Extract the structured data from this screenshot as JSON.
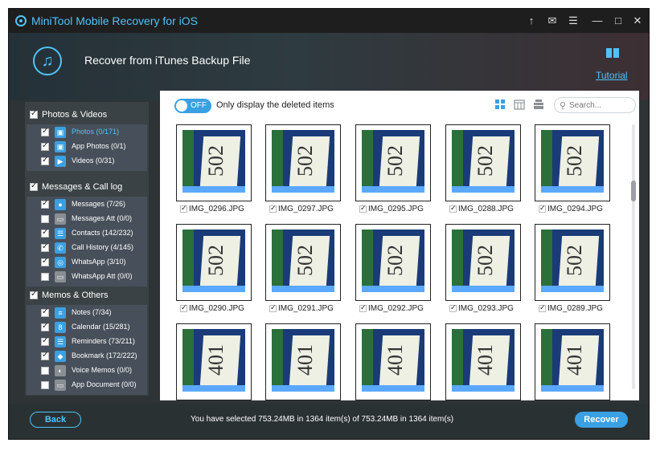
{
  "window": {
    "title": "MiniTool Mobile Recovery for iOS",
    "controls": [
      "↑",
      "✉",
      "☰",
      "—",
      "□",
      "✕"
    ]
  },
  "header": {
    "title": "Recover from iTunes Backup File",
    "tutorial_label": "Tutorial"
  },
  "sidebar": {
    "groups": [
      {
        "label": "Photos & Videos",
        "checked": true,
        "items": [
          {
            "label": "Photos (0/171)",
            "checked": true,
            "icon": "photo-icon",
            "selected": true
          },
          {
            "label": "App Photos (0/1)",
            "checked": true,
            "icon": "app-photo-icon"
          },
          {
            "label": "Videos (0/31)",
            "checked": true,
            "icon": "video-icon"
          }
        ]
      },
      {
        "label": "Messages & Call log",
        "checked": true,
        "items": [
          {
            "label": "Messages (7/26)",
            "checked": true,
            "icon": "message-icon"
          },
          {
            "label": "Messages Att (0/0)",
            "checked": false,
            "icon": "attachment-icon",
            "disabled": true
          },
          {
            "label": "Contacts (142/232)",
            "checked": true,
            "icon": "contacts-icon"
          },
          {
            "label": "Call History (4/145)",
            "checked": true,
            "icon": "call-history-icon"
          },
          {
            "label": "WhatsApp (3/10)",
            "checked": true,
            "icon": "whatsapp-icon"
          },
          {
            "label": "WhatsApp Att (0/0)",
            "checked": false,
            "icon": "whatsapp-att-icon",
            "disabled": true
          }
        ]
      },
      {
        "label": "Memos & Others",
        "checked": true,
        "items": [
          {
            "label": "Notes (7/34)",
            "checked": true,
            "icon": "notes-icon"
          },
          {
            "label": "Calendar (15/281)",
            "checked": true,
            "icon": "calendar-icon"
          },
          {
            "label": "Reminders (73/211)",
            "checked": true,
            "icon": "reminders-icon"
          },
          {
            "label": "Bookmark (172/222)",
            "checked": true,
            "icon": "bookmark-icon"
          },
          {
            "label": "Voice Memos (0/0)",
            "checked": false,
            "icon": "voice-memo-icon",
            "disabled": true
          },
          {
            "label": "App Document (0/0)",
            "checked": false,
            "icon": "app-document-icon",
            "disabled": true
          }
        ]
      }
    ]
  },
  "toolbar": {
    "toggle_label": "OFF",
    "only_deleted_label": "Only display the deleted items",
    "search_placeholder": "Search..."
  },
  "photos": {
    "rows": [
      {
        "number": "502",
        "files": [
          "IMG_0296.JPG",
          "IMG_0297.JPG",
          "IMG_0295.JPG",
          "IMG_0288.JPG",
          "IMG_0294.JPG"
        ]
      },
      {
        "number": "502",
        "files": [
          "IMG_0290.JPG",
          "IMG_0291.JPG",
          "IMG_0292.JPG",
          "IMG_0293.JPG",
          "IMG_0289.JPG"
        ]
      },
      {
        "number": "401",
        "files": [
          "",
          "",
          "",
          "",
          ""
        ]
      }
    ]
  },
  "footer": {
    "back_label": "Back",
    "status": "You have selected 753.24MB in 1364 item(s) of 753.24MB in 1364 item(s)",
    "recover_label": "Recover"
  },
  "colors": {
    "accent": "#3aa0e4",
    "title_accent": "#4fc3f7",
    "dark_bg": "#2e3436"
  }
}
